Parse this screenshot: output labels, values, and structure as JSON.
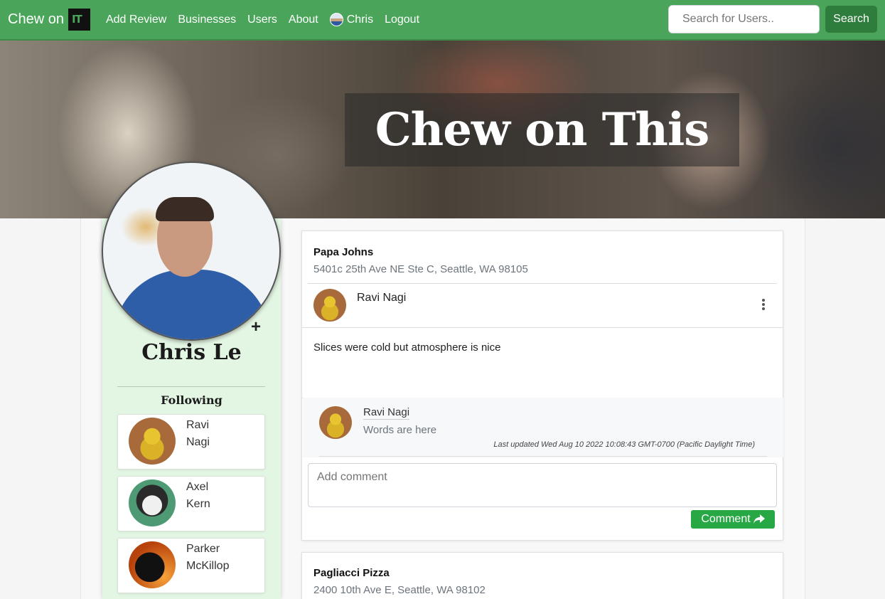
{
  "nav": {
    "brand": "Chew on",
    "brand_logo_text": "IT",
    "links": [
      "Add Review",
      "Businesses",
      "Users",
      "About"
    ],
    "user": "Chris",
    "logout": "Logout",
    "search_placeholder": "Search for Users..",
    "search_button": "Search"
  },
  "hero": {
    "title": "Chew on This"
  },
  "profile": {
    "name": "Chris Le",
    "following_title": "Following",
    "following": [
      {
        "first": "Ravi",
        "last": "Nagi"
      },
      {
        "first": "Axel",
        "last": "Kern"
      },
      {
        "first": "Parker",
        "last": "McKillop"
      }
    ]
  },
  "reviews": [
    {
      "business": "Papa Johns",
      "address": "5401c 25th Ave NE Ste C, Seattle, WA 98105",
      "reviewer": "Ravi Nagi",
      "text": "Slices were cold but atmosphere is nice",
      "comment": {
        "author": "Ravi Nagi",
        "text": "Words are here",
        "timestamp": "Last updated Wed Aug 10 2022 10:08:43 GMT-0700 (Pacific Daylight Time)"
      },
      "comment_placeholder": "Add comment",
      "comment_button": "Comment"
    },
    {
      "business": "Pagliacci Pizza",
      "address": "2400 10th Ave E, Seattle, WA 98102"
    }
  ],
  "colors": {
    "nav_green": "#4aa55a",
    "button_green": "#28a745",
    "profile_bg": "#e3f5e3"
  }
}
